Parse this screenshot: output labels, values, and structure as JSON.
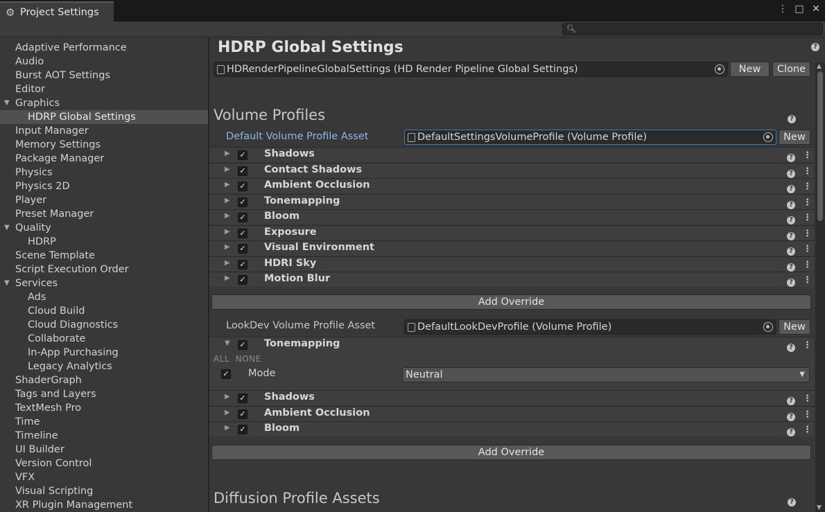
{
  "window": {
    "tab_title": "Project Settings",
    "tab_icon": "gear-icon"
  },
  "search": {
    "placeholder": "",
    "value": ""
  },
  "sidebar": {
    "items": [
      {
        "label": "Adaptive Performance",
        "level": 0
      },
      {
        "label": "Audio",
        "level": 0
      },
      {
        "label": "Burst AOT Settings",
        "level": 0
      },
      {
        "label": "Editor",
        "level": 0
      },
      {
        "label": "Graphics",
        "level": 0,
        "foldout": "expanded"
      },
      {
        "label": "HDRP Global Settings",
        "level": 1,
        "selected": true
      },
      {
        "label": "Input Manager",
        "level": 0
      },
      {
        "label": "Memory Settings",
        "level": 0
      },
      {
        "label": "Package Manager",
        "level": 0
      },
      {
        "label": "Physics",
        "level": 0
      },
      {
        "label": "Physics 2D",
        "level": 0
      },
      {
        "label": "Player",
        "level": 0
      },
      {
        "label": "Preset Manager",
        "level": 0
      },
      {
        "label": "Quality",
        "level": 0,
        "foldout": "expanded"
      },
      {
        "label": "HDRP",
        "level": 1
      },
      {
        "label": "Scene Template",
        "level": 0
      },
      {
        "label": "Script Execution Order",
        "level": 0
      },
      {
        "label": "Services",
        "level": 0,
        "foldout": "expanded"
      },
      {
        "label": "Ads",
        "level": 1
      },
      {
        "label": "Cloud Build",
        "level": 1
      },
      {
        "label": "Cloud Diagnostics",
        "level": 1
      },
      {
        "label": "Collaborate",
        "level": 1
      },
      {
        "label": "In-App Purchasing",
        "level": 1
      },
      {
        "label": "Legacy Analytics",
        "level": 1
      },
      {
        "label": "ShaderGraph",
        "level": 0
      },
      {
        "label": "Tags and Layers",
        "level": 0
      },
      {
        "label": "TextMesh Pro",
        "level": 0
      },
      {
        "label": "Time",
        "level": 0
      },
      {
        "label": "Timeline",
        "level": 0
      },
      {
        "label": "UI Builder",
        "level": 0
      },
      {
        "label": "Version Control",
        "level": 0
      },
      {
        "label": "VFX",
        "level": 0
      },
      {
        "label": "Visual Scripting",
        "level": 0
      },
      {
        "label": "XR Plugin Management",
        "level": 0
      }
    ]
  },
  "main": {
    "title": "HDRP Global Settings",
    "global_asset": {
      "value": "HDRenderPipelineGlobalSettings (HD Render Pipeline Global Settings)",
      "new_label": "New",
      "clone_label": "Clone"
    },
    "volume_profiles": {
      "title": "Volume Profiles",
      "default_label": "Default Volume Profile Asset",
      "default_value": "DefaultSettingsVolumeProfile (Volume Profile)",
      "default_new_label": "New",
      "default_components": [
        {
          "name": "Shadows",
          "checked": true
        },
        {
          "name": "Contact Shadows",
          "checked": true
        },
        {
          "name": "Ambient Occlusion",
          "checked": true
        },
        {
          "name": "Tonemapping",
          "checked": true
        },
        {
          "name": "Bloom",
          "checked": true
        },
        {
          "name": "Exposure",
          "checked": true
        },
        {
          "name": "Visual Environment",
          "checked": true
        },
        {
          "name": "HDRI Sky",
          "checked": true
        },
        {
          "name": "Motion Blur",
          "checked": true
        }
      ],
      "add_override_label": "Add Override",
      "lookdev_label": "LookDev Volume Profile Asset",
      "lookdev_value": "DefaultLookDevProfile (Volume Profile)",
      "lookdev_new_label": "New",
      "lookdev_expanded": {
        "name": "Tonemapping",
        "checked": true,
        "all_label": "ALL",
        "none_label": "NONE",
        "mode_label": "Mode",
        "mode_value": "Neutral",
        "mode_checked": true
      },
      "lookdev_components": [
        {
          "name": "Shadows",
          "checked": true
        },
        {
          "name": "Ambient Occlusion",
          "checked": true
        },
        {
          "name": "Bloom",
          "checked": true
        }
      ],
      "add_override_label_2": "Add Override"
    },
    "diffusion": {
      "title": "Diffusion Profile Assets"
    }
  },
  "colors": {
    "modified_label": "#8fb6ee",
    "focus_border": "#3a79bb",
    "selected_row": "#505050"
  }
}
